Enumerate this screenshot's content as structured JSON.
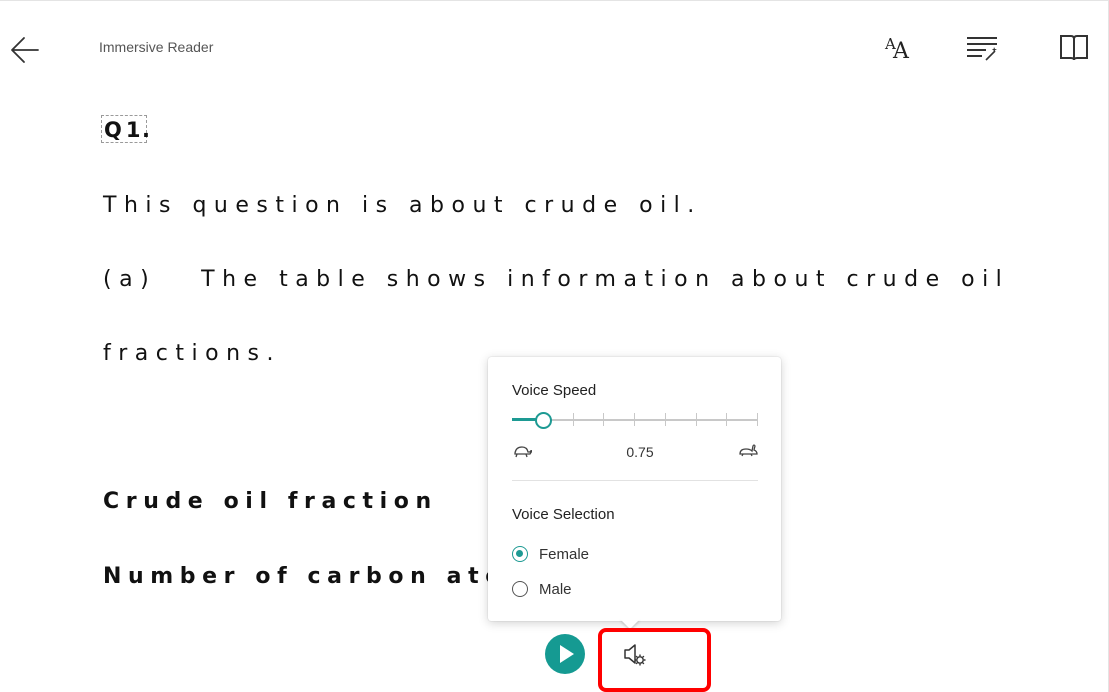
{
  "header": {
    "title": "Immersive Reader",
    "back_icon": "arrow-left-icon",
    "tools": [
      {
        "name": "text-preferences",
        "icon": "font-size-aa-icon"
      },
      {
        "name": "grammar-options",
        "icon": "grammar-wand-icon"
      },
      {
        "name": "reading-preferences",
        "icon": "open-book-icon"
      }
    ]
  },
  "document": {
    "question_label": "Q1",
    "question_dot": ".",
    "line1": "This question is about crude oil.",
    "line2_part_label": "(a)",
    "line2_text": "The table shows information about crude oil",
    "line3": "fractions.",
    "line4": "Crude oil fraction",
    "line5": "Number of carbon atom"
  },
  "voice_popup": {
    "speed_title": "Voice Speed",
    "speed_value": "0.75",
    "speed_level_fraction": 0.125,
    "speed_steps": 8,
    "slow_icon": "turtle-icon",
    "fast_icon": "rabbit-icon",
    "selection_title": "Voice Selection",
    "options": [
      {
        "label": "Female",
        "selected": true
      },
      {
        "label": "Male",
        "selected": false
      }
    ]
  },
  "controls": {
    "play_icon": "play-icon",
    "voice_settings_icon": "speaker-gear-icon"
  },
  "colors": {
    "accent": "#1d9a93",
    "play_button": "#159a92",
    "highlight": "#ff0000"
  }
}
